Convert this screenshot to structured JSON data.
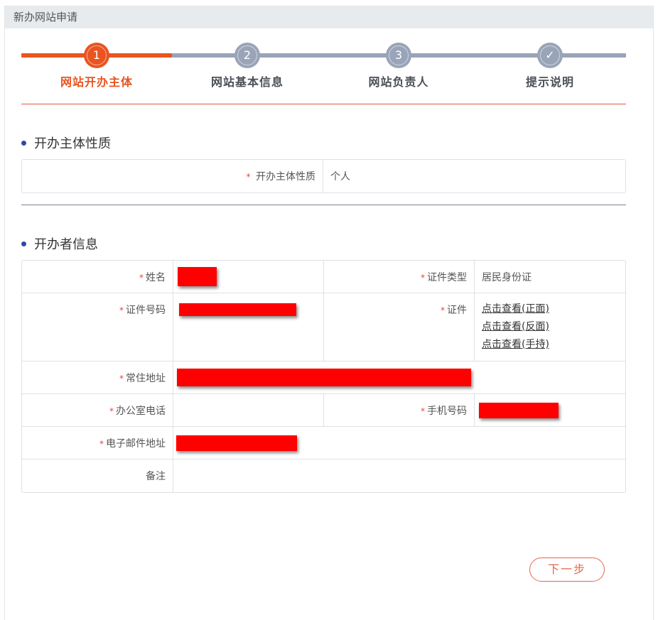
{
  "header": {
    "title": "新办网站申请"
  },
  "stepper": {
    "steps": [
      {
        "number": "1",
        "label": "网站开办主体",
        "state": "active"
      },
      {
        "number": "2",
        "label": "网站基本信息",
        "state": "pending"
      },
      {
        "number": "3",
        "label": "网站负责人",
        "state": "pending"
      },
      {
        "number": "✓",
        "label": "提示说明",
        "state": "pending"
      }
    ]
  },
  "section_entity": {
    "title": "开办主体性质",
    "field_label": "开办主体性质",
    "field_value": "个人"
  },
  "section_owner": {
    "title": "开办者信息",
    "name_label": "姓名",
    "id_type_label": "证件类型",
    "id_type_value": "居民身份证",
    "id_number_label": "证件号码",
    "id_doc_label": "证件",
    "id_links": [
      "点击查看(正面)",
      "点击查看(反面)",
      "点击查看(手持)"
    ],
    "address_label": "常住地址",
    "office_phone_label": "办公室电话",
    "mobile_label": "手机号码",
    "email_label": "电子邮件地址",
    "remark_label": "备注"
  },
  "required_mark": "*",
  "buttons": {
    "next": "下一步"
  },
  "colors": {
    "accent": "#e95420",
    "inactive_step": "#99a4b8",
    "redaction": "#ff0000",
    "bullet": "#2e4aa8"
  }
}
